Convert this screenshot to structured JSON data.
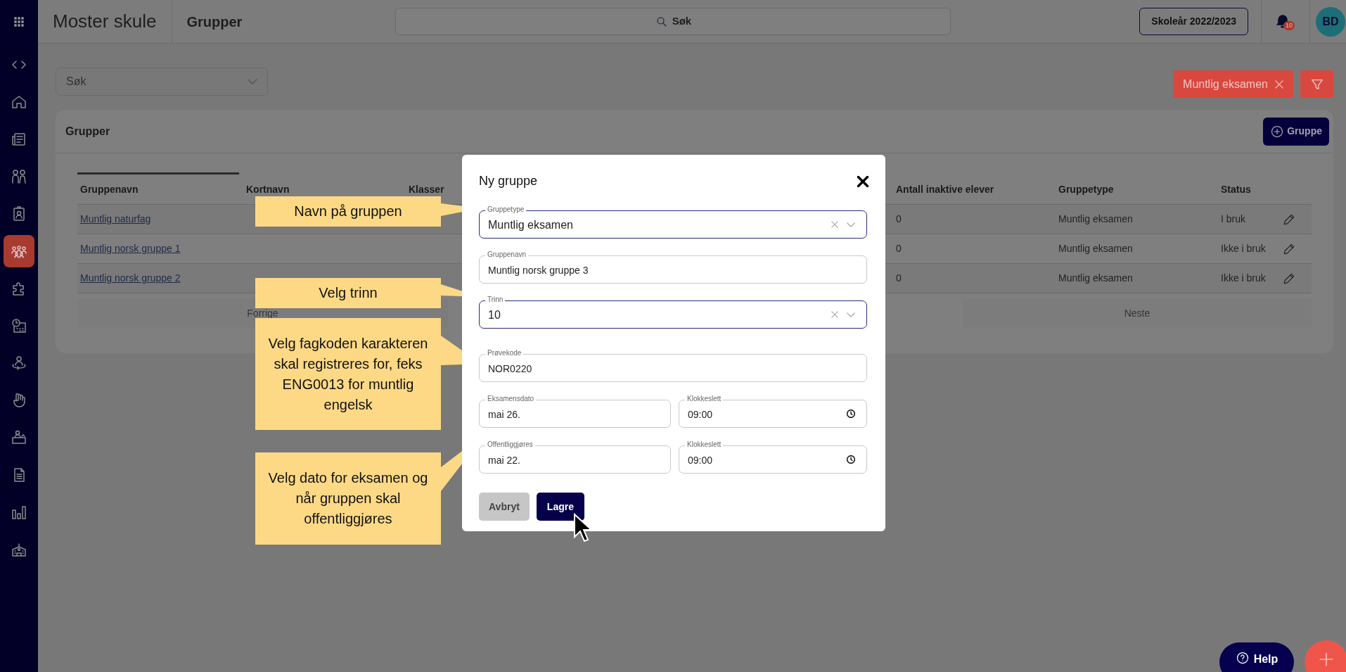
{
  "app": {
    "title": "Moster skule",
    "page": "Grupper"
  },
  "topbar": {
    "search": "Søk",
    "school_year": "Skoleår 2022/2023",
    "notifications": "10",
    "avatar": "BD"
  },
  "sidebar": {
    "items": [
      {
        "selected": false
      },
      {
        "selected": false
      },
      {
        "selected": false
      },
      {
        "selected": false
      },
      {
        "selected": false
      },
      {
        "selected": true
      },
      {
        "selected": false
      },
      {
        "selected": false
      },
      {
        "selected": false
      },
      {
        "selected": false
      },
      {
        "selected": false
      },
      {
        "selected": false
      },
      {
        "selected": false
      },
      {
        "selected": false
      }
    ]
  },
  "filters": {
    "search_placeholder": "Søk",
    "active": [
      {
        "label": "Muntlig eksamen"
      }
    ]
  },
  "card": {
    "title": "Grupper",
    "add_button": "Gruppe",
    "columns": [
      "Gruppenavn",
      "Kortnavn",
      "Klasser",
      "Antall inaktive elever",
      "Gruppetype",
      "Status"
    ],
    "rows": [
      {
        "name": "Muntlig naturfag",
        "inactive": "0",
        "type": "Muntlig eksamen",
        "status": "I bruk"
      },
      {
        "name": "Muntlig norsk gruppe 1",
        "inactive": "0",
        "type": "Muntlig eksamen",
        "status": "Ikke i bruk"
      },
      {
        "name": "Muntlig norsk gruppe 2",
        "inactive": "0",
        "type": "Muntlig eksamen",
        "status": "Ikke i bruk"
      }
    ],
    "prev": "Forrige",
    "next": "Neste"
  },
  "dialog": {
    "title": "Ny gruppe",
    "fields": [
      {
        "kind": "select",
        "label": "Gruppetype",
        "value": "Muntlig eksamen",
        "focused": true
      },
      {
        "kind": "text",
        "label": "Gruppenavn",
        "value": "Muntlig norsk gruppe 3",
        "focused": false
      },
      {
        "kind": "select",
        "label": "Trinn",
        "value": "10",
        "focused": true
      },
      {
        "kind": "text",
        "label": "Prøvekode",
        "value": "NOR0220",
        "focused": false
      },
      {
        "kind": "pair",
        "left": {
          "label": "Eksamensdato",
          "value": "mai 26."
        },
        "right": {
          "label": "Klokkeslett",
          "value": "09:00"
        }
      },
      {
        "kind": "pair",
        "left": {
          "label": "Offentliggjøres",
          "value": "mai 22."
        },
        "right": {
          "label": "Klokkeslett",
          "value": "09:00"
        }
      }
    ],
    "cancel": "Avbryt",
    "save": "Lagre"
  },
  "callouts": [
    "Navn på gruppen",
    "Velg trinn",
    "Velg fagkoden karakteren skal registreres for, feks ENG0013 for muntlig engelsk",
    "Velg dato for eksamen og når gruppen skal offentliggjøres"
  ],
  "help": "Help"
}
